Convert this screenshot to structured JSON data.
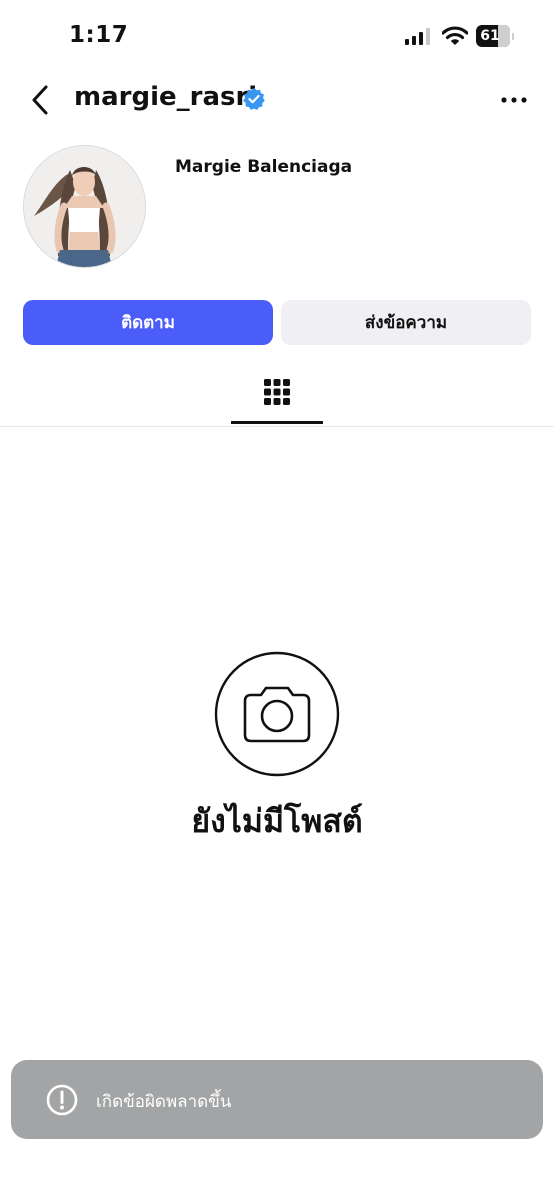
{
  "status_bar": {
    "time": "1:17",
    "battery_level": "61"
  },
  "header": {
    "username": "margie_rasri",
    "verified_badge_icon": "verified-badge-icon",
    "back_icon": "chevron-left-icon",
    "more_icon": "more-horizontal-icon"
  },
  "profile": {
    "display_name": "Margie Balenciaga",
    "avatar": "profile-photo"
  },
  "actions": {
    "follow_label": "ติดตาม",
    "message_label": "ส่งข้อความ"
  },
  "tabs": {
    "grid_icon": "grid-icon"
  },
  "empty_state": {
    "icon": "camera-icon",
    "message": "ยังไม่มีโพสต์"
  },
  "toast": {
    "icon": "alert-circle-icon",
    "message": "เกิดข้อผิดพลาดขึ้น"
  },
  "colors": {
    "primary": "#4a5df9",
    "secondary_button": "#efeff4",
    "verified_blue": "#3897f0",
    "toast_bg": "#a2a4a6"
  }
}
